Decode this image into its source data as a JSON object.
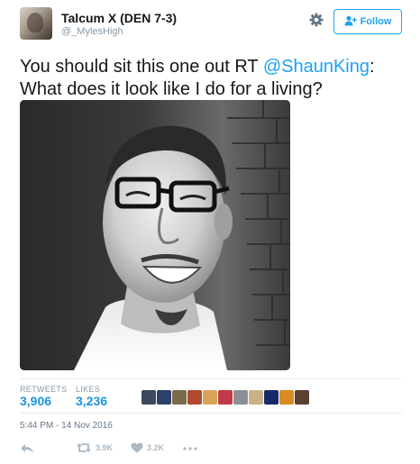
{
  "header": {
    "display_name": "Talcum X (DEN 7-3)",
    "handle": "@_MylesHigh",
    "gear_icon": "gear-icon",
    "follow_label": "Follow",
    "follow_icon": "add-user-icon"
  },
  "tweet": {
    "text_before_mention": "You should sit this one out RT ",
    "mention": "@ShaunKing",
    "text_after_mention": ":",
    "text_line2": "What does it look like I do for a living?"
  },
  "stats": {
    "retweets_label": "RETWEETS",
    "retweets_value": "3,906",
    "likes_label": "LIKES",
    "likes_value": "3,236",
    "liker_avatar_colors": [
      "#3b4a5c",
      "#2d3f6b",
      "#7a6a4a",
      "#b04a2f",
      "#d9a45a",
      "#c23a4a",
      "#8c8f96",
      "#c9b28a",
      "#1a2a66",
      "#d98a20",
      "#5a4030"
    ]
  },
  "timestamp": "5:44 PM - 14 Nov 2016",
  "actions": {
    "reply_icon": "reply-icon",
    "retweet_icon": "retweet-icon",
    "retweet_count": "3.9K",
    "like_icon": "heart-icon",
    "like_count": "3.2K",
    "more_icon": "more-icon"
  },
  "colors": {
    "accent": "#1da1f2",
    "link": "#1b95e0",
    "muted": "#8899a6",
    "divider": "#e6ecf0"
  }
}
